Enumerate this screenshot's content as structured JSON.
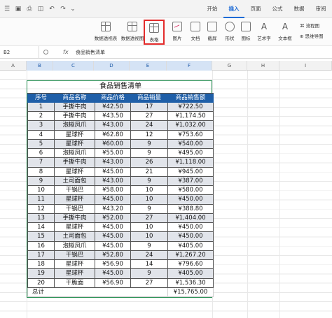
{
  "tabs": [
    "开始",
    "插入",
    "页面",
    "公式",
    "数据",
    "审阅"
  ],
  "active_tab": "插入",
  "ribbon": {
    "pivot_table": "数据透视表",
    "pivot_chart": "数据透视图",
    "table": "表格",
    "picture": "图片",
    "document": "文档",
    "screenshot": "截屏",
    "shape": "形状",
    "icon": "图标",
    "wordart": "艺术字",
    "textbox": "文本框",
    "flowchart": "流程图",
    "mindmap": "思维导图"
  },
  "name_box": "B2",
  "formula_value": "食品销售清单",
  "columns": [
    "A",
    "B",
    "C",
    "D",
    "E",
    "F",
    "G",
    "H",
    "I"
  ],
  "sheet": {
    "title": "食品销售清单",
    "headers": [
      "序号",
      "商品名称",
      "商品价格",
      "商品销量",
      "商品销售额"
    ],
    "rows": [
      [
        "1",
        "手撕牛肉",
        "¥42.50",
        "17",
        "¥722.50"
      ],
      [
        "2",
        "手撕牛肉",
        "¥43.50",
        "27",
        "¥1,174.50"
      ],
      [
        "3",
        "泡椒凤爪",
        "¥43.00",
        "24",
        "¥1,032.00"
      ],
      [
        "4",
        "星球杯",
        "¥62.80",
        "12",
        "¥753.60"
      ],
      [
        "5",
        "星球杯",
        "¥60.00",
        "9",
        "¥540.00"
      ],
      [
        "6",
        "泡椒凤爪",
        "¥55.00",
        "9",
        "¥495.00"
      ],
      [
        "7",
        "手撕牛肉",
        "¥43.00",
        "26",
        "¥1,118.00"
      ],
      [
        "8",
        "星球杯",
        "¥45.00",
        "21",
        "¥945.00"
      ],
      [
        "9",
        "土司面包",
        "¥43.00",
        "9",
        "¥387.00"
      ],
      [
        "10",
        "干锅巴",
        "¥58.00",
        "10",
        "¥580.00"
      ],
      [
        "11",
        "星球杯",
        "¥45.00",
        "10",
        "¥450.00"
      ],
      [
        "12",
        "干锅巴",
        "¥43.20",
        "9",
        "¥388.80"
      ],
      [
        "13",
        "手撕牛肉",
        "¥52.00",
        "27",
        "¥1,404.00"
      ],
      [
        "14",
        "星球杯",
        "¥45.00",
        "10",
        "¥450.00"
      ],
      [
        "15",
        "土司面包",
        "¥45.00",
        "10",
        "¥450.00"
      ],
      [
        "16",
        "泡椒凤爪",
        "¥45.00",
        "9",
        "¥405.00"
      ],
      [
        "17",
        "干锅巴",
        "¥52.80",
        "24",
        "¥1,267.20"
      ],
      [
        "18",
        "星球杯",
        "¥56.90",
        "14",
        "¥796.60"
      ],
      [
        "19",
        "星球杯",
        "¥45.00",
        "9",
        "¥405.00"
      ],
      [
        "20",
        "干脆面",
        "¥56.90",
        "27",
        "¥1,536.30"
      ]
    ],
    "total_label": "总计",
    "total_value": "¥15,765.00"
  }
}
